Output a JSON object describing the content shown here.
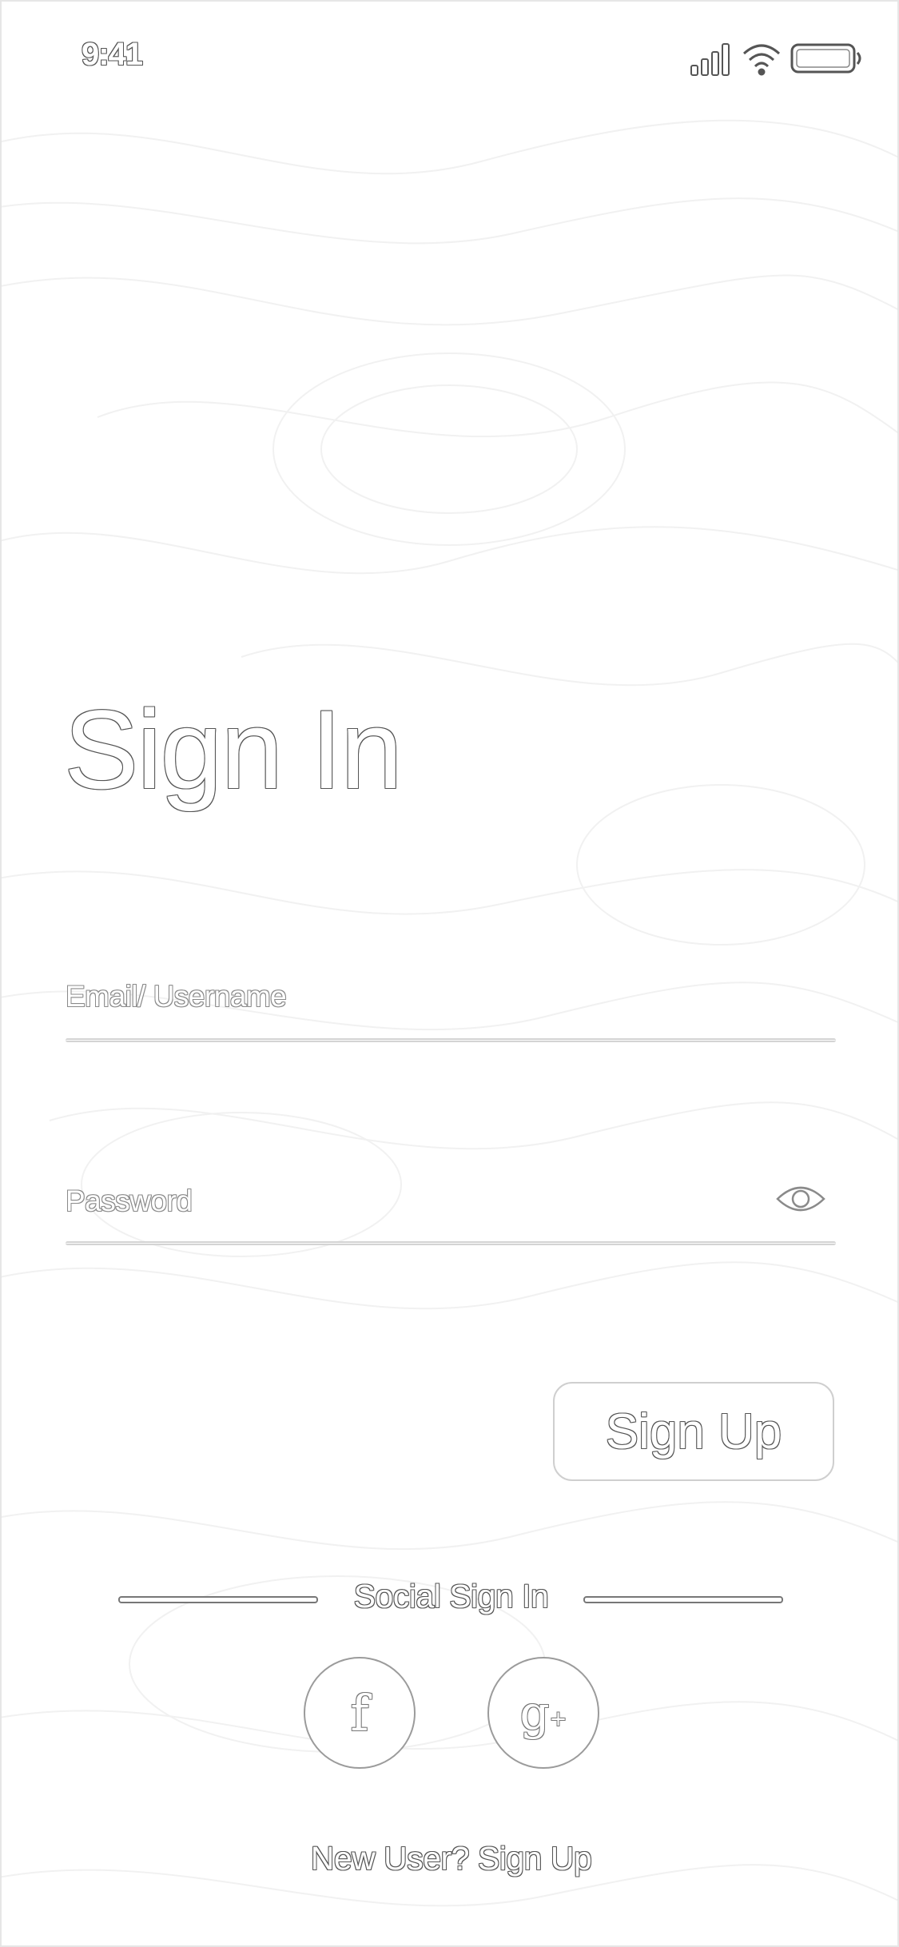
{
  "status_bar": {
    "time": "9:41",
    "icons": [
      "signal-icon",
      "wifi-icon",
      "battery-icon"
    ]
  },
  "page": {
    "title": "Sign In"
  },
  "form": {
    "email_label": "Email/ Username",
    "password_label": "Password",
    "password_toggle_icon": "eye-icon",
    "signup_button": "Sign Up"
  },
  "social": {
    "title": "Social Sign In",
    "providers": [
      {
        "name": "facebook",
        "glyph": "f",
        "icon": "facebook-icon"
      },
      {
        "name": "google-plus",
        "glyph": "g",
        "sup": "+",
        "icon": "google-plus-icon"
      }
    ]
  },
  "footer": {
    "prompt": "New User?",
    "link": "Sign Up"
  },
  "colors": {
    "background": "#ffffff",
    "outline": "#555555",
    "line": "#d4d4d4"
  }
}
